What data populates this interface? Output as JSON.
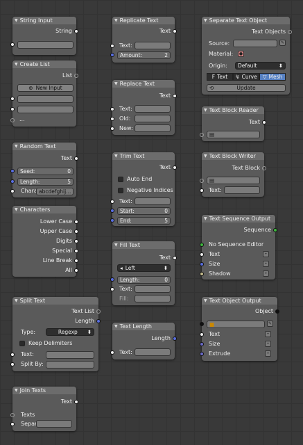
{
  "string_input": {
    "title": "String Input",
    "out": "String"
  },
  "create_list": {
    "title": "Create List",
    "out": "List",
    "new_input": "New Input",
    "more": "..."
  },
  "random_text": {
    "title": "Random Text",
    "out": "Text",
    "seed_label": "Seed:",
    "seed": "0",
    "length_label": "Length:",
    "length": "5",
    "chars_label": "Chara",
    "chars": "abcdefghij..."
  },
  "characters": {
    "title": "Characters",
    "outs": [
      "Lower Case",
      "Upper Case",
      "Digits",
      "Special",
      "Line Break",
      "All"
    ]
  },
  "split_text": {
    "title": "Split Text",
    "out1": "Text List",
    "out2": "Length",
    "type_label": "Type:",
    "type_value": "Regexp",
    "keep": "Keep Delimiters",
    "text_label": "Text:",
    "split_label": "Split By:"
  },
  "join_texts": {
    "title": "Join Texts",
    "out": "Text",
    "in1": "Texts",
    "in2": "Separ"
  },
  "replicate_text": {
    "title": "Replicate Text",
    "out": "Text",
    "text_label": "Text:",
    "amount_label": "Amount:",
    "amount": "2"
  },
  "replace_text": {
    "title": "Replace Text",
    "out": "Text",
    "text_label": "Text:",
    "old_label": "Old:",
    "new_label": "New:"
  },
  "trim_text": {
    "title": "Trim Text",
    "out": "Text",
    "auto_end": "Auto End",
    "neg_idx": "Negative Indices",
    "text_label": "Text:",
    "start_label": "Start:",
    "start": "0",
    "end_label": "End:",
    "end": "5"
  },
  "fill_text": {
    "title": "Fill Text",
    "out": "Text",
    "align": "Left",
    "length_label": "Length:",
    "length": "0",
    "text_label": "Text:",
    "fill_label": "Fill:"
  },
  "text_length": {
    "title": "Text Length",
    "out": "Length",
    "text_label": "Text:"
  },
  "separate_text": {
    "title": "Separate Text Object",
    "out": "Text Objects",
    "source_label": "Source:",
    "material_label": "Material:",
    "origin_label": "Origin:",
    "origin_value": "Default",
    "seg": [
      "Text",
      "Curve",
      "Mesh"
    ],
    "update": "Update"
  },
  "text_block_reader": {
    "title": "Text Block Reader",
    "out": "Text"
  },
  "text_block_writer": {
    "title": "Text Block Writer",
    "out": "Text Block",
    "text_label": "Text:"
  },
  "text_seq_output": {
    "title": "Text Sequence Output",
    "out": "Sequence",
    "in1": "No Sequence Editor",
    "in2": "Text",
    "in3": "Size",
    "in4": "Shadow"
  },
  "text_obj_output": {
    "title": "Text Object Output",
    "out": "Object",
    "in1": "Text",
    "in2": "Size",
    "in3": "Extrude"
  }
}
